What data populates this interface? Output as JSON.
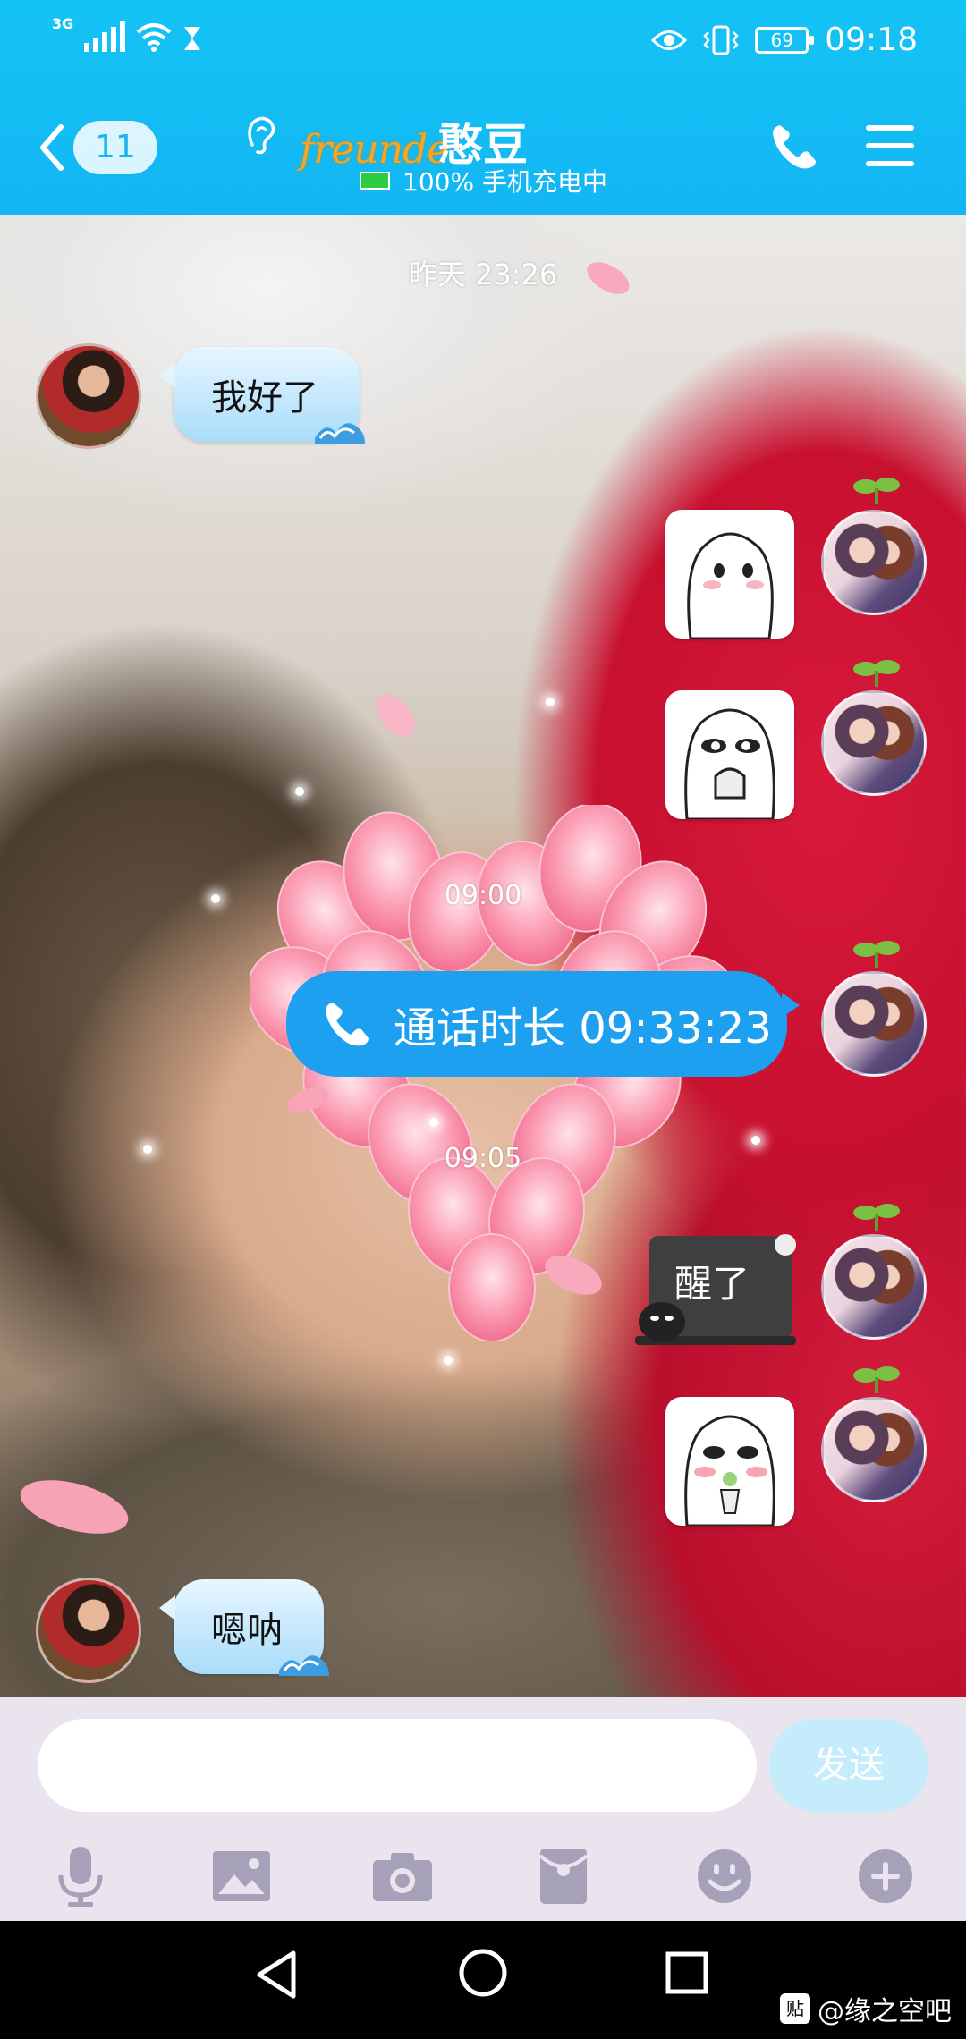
{
  "status_bar": {
    "network": "3G",
    "battery": "69",
    "time": "09:18"
  },
  "header": {
    "unread_count": "11",
    "brand_text": "freunde",
    "contact_name": "憨豆",
    "subtitle": "100% 手机充电中"
  },
  "chat": {
    "time_labels": [
      "昨天 23:26",
      "09:00",
      "09:05"
    ],
    "messages": {
      "m1": "我好了",
      "call": "通话时长 09:33:23",
      "sticker_text": "醒了",
      "m_last": "嗯呐"
    }
  },
  "input": {
    "placeholder": "",
    "send_label": "发送"
  },
  "watermark": {
    "box": "贴",
    "text": "@缘之空吧"
  },
  "colors": {
    "header_bg": "#14c3f5",
    "call_bubble": "#1ea0f0",
    "send_button": "#c4ecfb",
    "input_bar": "#e9e4ee"
  },
  "icons": [
    "signal-icon",
    "wifi-icon",
    "hourglass-icon",
    "eye-icon",
    "vibrate-icon",
    "battery-icon",
    "back-icon",
    "ear-icon",
    "phone-icon",
    "menu-icon",
    "microphone-icon",
    "image-icon",
    "camera-icon",
    "red-packet-icon",
    "emoji-icon",
    "plus-icon",
    "nav-back-icon",
    "nav-home-icon",
    "nav-recents-icon"
  ]
}
